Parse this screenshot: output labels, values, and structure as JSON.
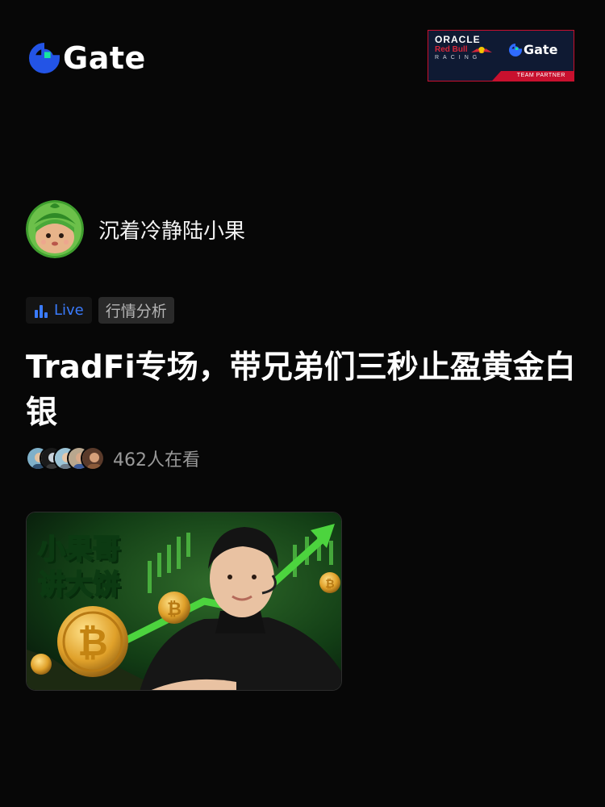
{
  "header": {
    "logo_text": "Gate",
    "partner": {
      "oracle": "ORACLE",
      "redbull": "Red Bull",
      "racing": "RACING",
      "gate": "Gate",
      "strip": "TEAM PARTNER"
    }
  },
  "user": {
    "name": "沉着冷静陆小果"
  },
  "tags": {
    "live": "Live",
    "category": "行情分析"
  },
  "post": {
    "title": "TradFi专场，带兄弟们三秒止盈黄金白银"
  },
  "viewers": {
    "count_text": "462人在看"
  },
  "thumbnail": {
    "line1": "小果哥",
    "line2": "讲大饼"
  },
  "colors": {
    "background": "#070707",
    "live_blue": "#3a7bfd",
    "gate_blue": "#2354e6",
    "gate_green": "#17e5a0",
    "partner_red": "#c8102e"
  },
  "icons": {
    "live": "bar-chart-icon",
    "logo": "gate-logo-icon"
  }
}
